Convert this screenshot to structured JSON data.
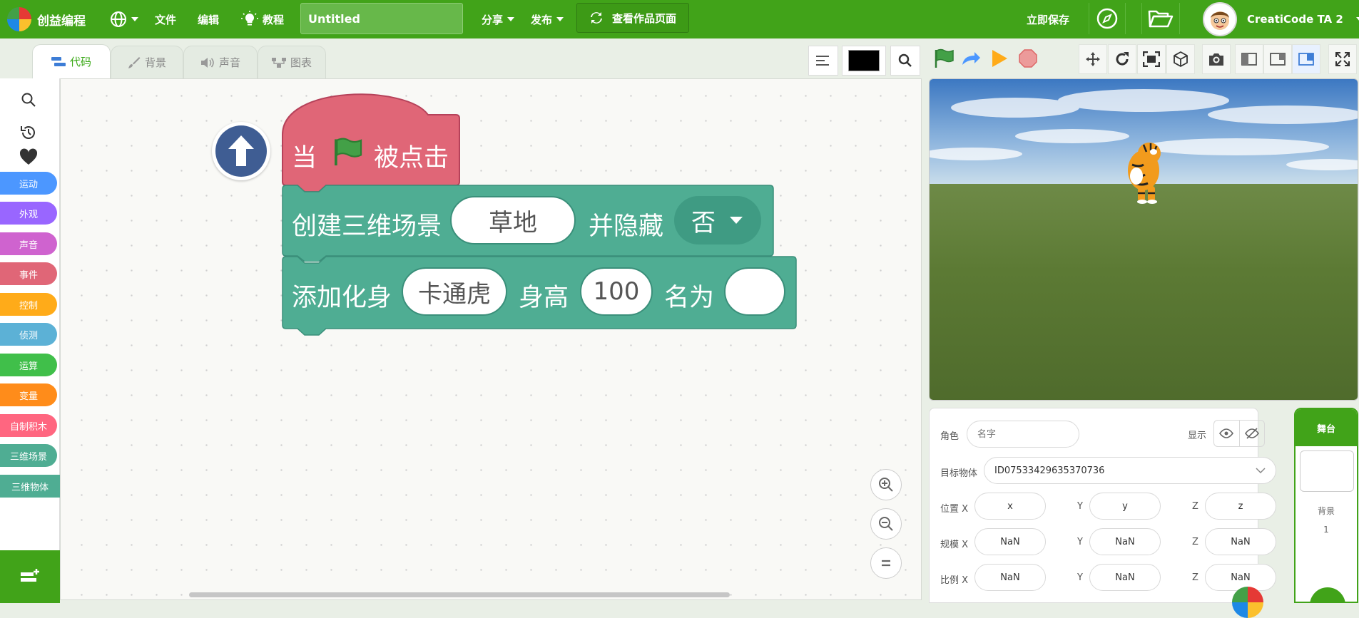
{
  "app": {
    "name": "创益编程",
    "title_value": "Untitled"
  },
  "menu": {
    "file": "文件",
    "edit": "编辑",
    "tutorial": "教程",
    "share": "分享",
    "publish": "发布",
    "view_project": "查看作品页面",
    "save_now": "立即保存"
  },
  "user": {
    "name": "CreatiCode TA 2"
  },
  "tabs": [
    {
      "label": "代码"
    },
    {
      "label": "背景"
    },
    {
      "label": "声音"
    },
    {
      "label": "图表"
    }
  ],
  "categories": [
    {
      "label": "运动",
      "color": "#4c97ff"
    },
    {
      "label": "外观",
      "color": "#9966ff"
    },
    {
      "label": "声音",
      "color": "#cf63cf"
    },
    {
      "label": "事件",
      "color": "#e06677"
    },
    {
      "label": "控制",
      "color": "#ffab19"
    },
    {
      "label": "侦测",
      "color": "#5cb1d6"
    },
    {
      "label": "运算",
      "color": "#40bf4a"
    },
    {
      "label": "变量",
      "color": "#ff8c1a"
    },
    {
      "label": "自制积木",
      "color": "#ff6680"
    },
    {
      "label": "三维场景",
      "color": "#4fad93"
    },
    {
      "label": "三维物体",
      "color": "#4fad93"
    }
  ],
  "blocks": {
    "hat": {
      "when": "当",
      "clicked": "被点击"
    },
    "scene": {
      "text": "创建三维场景",
      "scene_value": "草地",
      "hide_label": "并隐藏",
      "hide_value": "否"
    },
    "avatar": {
      "text": "添加化身",
      "avatar_value": "卡通虎",
      "height_label": "身高",
      "height_value": "100",
      "name_label": "名为",
      "name_value": ""
    }
  },
  "props": {
    "sprite_label": "角色",
    "sprite_placeholder": "名字",
    "show_label": "显示",
    "target_label": "目标物体",
    "target_value": "ID07533429635370736",
    "pos_label": "位置 X",
    "pos": {
      "x": "x",
      "y": "y",
      "z": "z"
    },
    "scale_label": "规模 X",
    "scale": {
      "x": "NaN",
      "y": "NaN",
      "z": "NaN"
    },
    "ratio_label": "比例 X",
    "ratio": {
      "x": "NaN",
      "y": "NaN",
      "z": "NaN"
    },
    "y_label": "Y",
    "z_label": "Z"
  },
  "stage_panel": {
    "title": "舞台",
    "backdrop_label": "背景",
    "backdrop_count": "1"
  },
  "colors": {
    "brand": "#41a319",
    "event_block": "#e06677",
    "scene_block": "#4fad93"
  }
}
